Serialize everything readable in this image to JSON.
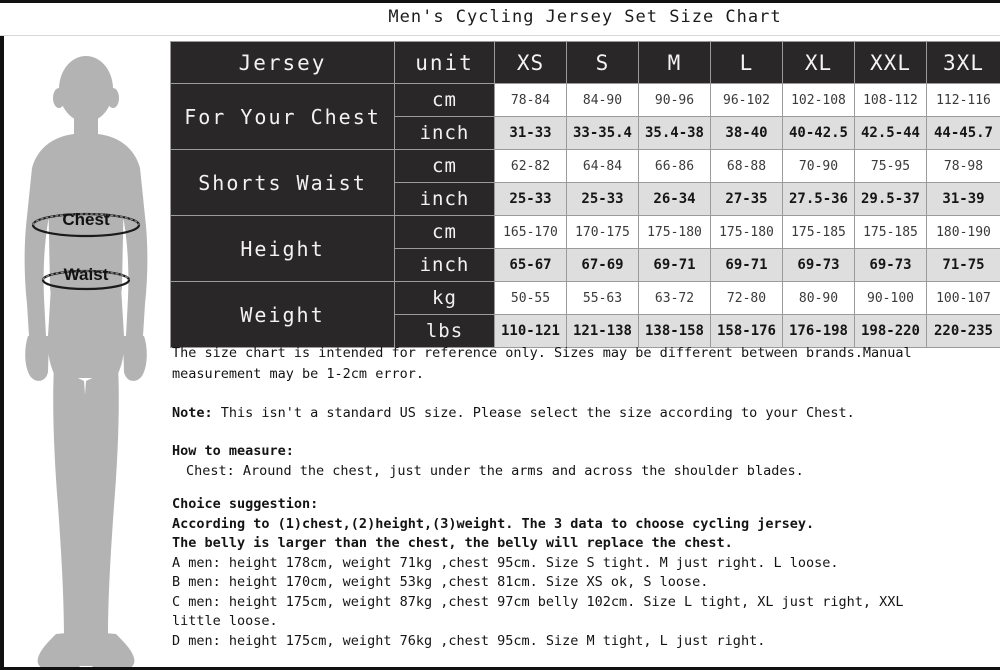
{
  "title": "Men's Cycling Jersey Set Size Chart",
  "figure": {
    "chest_label": "Chest",
    "waist_label": "Waist"
  },
  "table": {
    "corner_label": "Jersey",
    "unit_header": "unit",
    "sizes": [
      "XS",
      "S",
      "M",
      "L",
      "XL",
      "XXL",
      "3XL"
    ],
    "groups": [
      {
        "label": "For Your Chest",
        "rows": [
          {
            "unit": "cm",
            "style": "metric",
            "values": [
              "78-84",
              "84-90",
              "90-96",
              "96-102",
              "102-108",
              "108-112",
              "112-116"
            ]
          },
          {
            "unit": "inch",
            "style": "imperial",
            "values": [
              "31-33",
              "33-35.4",
              "35.4-38",
              "38-40",
              "40-42.5",
              "42.5-44",
              "44-45.7"
            ]
          }
        ]
      },
      {
        "label": "Shorts Waist",
        "rows": [
          {
            "unit": "cm",
            "style": "metric",
            "values": [
              "62-82",
              "64-84",
              "66-86",
              "68-88",
              "70-90",
              "75-95",
              "78-98"
            ]
          },
          {
            "unit": "inch",
            "style": "imperial",
            "values": [
              "25-33",
              "25-33",
              "26-34",
              "27-35",
              "27.5-36",
              "29.5-37",
              "31-39"
            ]
          }
        ]
      },
      {
        "label": "Height",
        "rows": [
          {
            "unit": "cm",
            "style": "metric",
            "values": [
              "165-170",
              "170-175",
              "175-180",
              "175-180",
              "175-185",
              "175-185",
              "180-190"
            ]
          },
          {
            "unit": "inch",
            "style": "imperial",
            "values": [
              "65-67",
              "67-69",
              "69-71",
              "69-71",
              "69-73",
              "69-73",
              "71-75"
            ]
          }
        ]
      },
      {
        "label": "Weight",
        "rows": [
          {
            "unit": "kg",
            "style": "metric",
            "values": [
              "50-55",
              "55-63",
              "63-72",
              "72-80",
              "80-90",
              "90-100",
              "100-107"
            ]
          },
          {
            "unit": "lbs",
            "style": "imperial",
            "values": [
              "110-121",
              "121-138",
              "138-158",
              "158-176",
              "176-198",
              "198-220",
              "220-235"
            ]
          }
        ]
      }
    ]
  },
  "notes": {
    "disclaimer": "The size chart is intended for reference only. Sizes may be different between brands.Manual\nmeasurement may be 1-2cm error.",
    "note_prefix": "Note:",
    "note_body": " This isn't a standard US size. Please select the size according to your Chest.",
    "how_to_measure_title": "How to measure:",
    "how_to_measure_body": "Chest: Around the chest, just under the arms and across the shoulder blades.",
    "choice_title": "Choice suggestion:",
    "choice_line1": "According to (1)chest,(2)height,(3)weight. The 3 data to choose cycling jersey.",
    "choice_line2": "The belly is larger than the chest, the belly will replace the chest.",
    "examples": [
      "A men: height 178cm, weight 71kg ,chest 95cm. Size S tight. M just right. L loose.",
      "B men: height 170cm, weight 53kg ,chest 81cm. Size XS ok, S loose.",
      "C men: height 175cm, weight 87kg ,chest 97cm belly 102cm. Size L tight, XL just right, XXL\nlittle loose.",
      "D men: height 175cm, weight 76kg ,chest 95cm. Size M tight, L just right."
    ]
  },
  "colors": {
    "header_dark": "#2a2729",
    "imperial_row": "#dedede",
    "metric_row": "#ffffff",
    "silhouette": "#b3b3b3",
    "text_dark": "#141414"
  }
}
